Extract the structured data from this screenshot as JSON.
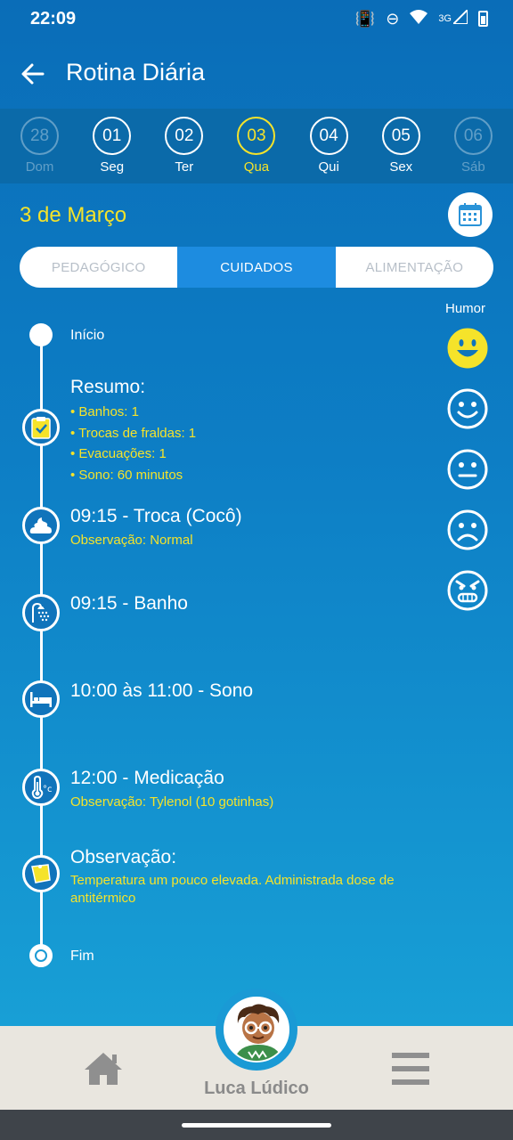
{
  "status_bar": {
    "time": "22:09",
    "network": "3G"
  },
  "app_bar": {
    "title": "Rotina Diária"
  },
  "days": [
    {
      "num": "28",
      "name": "Dom",
      "state": "faded"
    },
    {
      "num": "01",
      "name": "Seg",
      "state": "normal"
    },
    {
      "num": "02",
      "name": "Ter",
      "state": "normal"
    },
    {
      "num": "03",
      "name": "Qua",
      "state": "active"
    },
    {
      "num": "04",
      "name": "Qui",
      "state": "normal"
    },
    {
      "num": "05",
      "name": "Sex",
      "state": "normal"
    },
    {
      "num": "06",
      "name": "Sáb",
      "state": "faded"
    }
  ],
  "date_title": "3 de Março",
  "tabs": [
    {
      "label": "PEDAGÓGICO",
      "active": false
    },
    {
      "label": "CUIDADOS",
      "active": true
    },
    {
      "label": "ALIMENTAÇÃO",
      "active": false
    }
  ],
  "timeline": {
    "start": "Início",
    "summary": {
      "title": "Resumo:",
      "items": [
        "• Banhos: 1",
        "• Trocas de fraldas: 1",
        "• Evacuações: 1",
        "• Sono: 60 minutos"
      ]
    },
    "diaper": {
      "title": "09:15 - Troca (Cocô)",
      "obs": "Observação: Normal"
    },
    "bath": {
      "title": "09:15 - Banho"
    },
    "sleep": {
      "title": "10:00 às 11:00 - Sono"
    },
    "medication": {
      "title": "12:00 - Medicação",
      "obs": "Observação: Tylenol (10 gotinhas)"
    },
    "note": {
      "title": "Observação:",
      "obs": "Temperatura um pouco elevada. Administrada dose de antitérmico"
    },
    "end": "Fim"
  },
  "mood": {
    "label": "Humor",
    "selected": "very-happy",
    "options": [
      "very-happy",
      "happy",
      "neutral",
      "sad",
      "angry"
    ],
    "selected_color": "#f5e32a"
  },
  "bottom_nav": {
    "child_name": "Luca Lúdico"
  },
  "colors": {
    "accent": "#f5e32a",
    "primary": "#0d7ec5",
    "tab_active": "#1d8ce0"
  }
}
